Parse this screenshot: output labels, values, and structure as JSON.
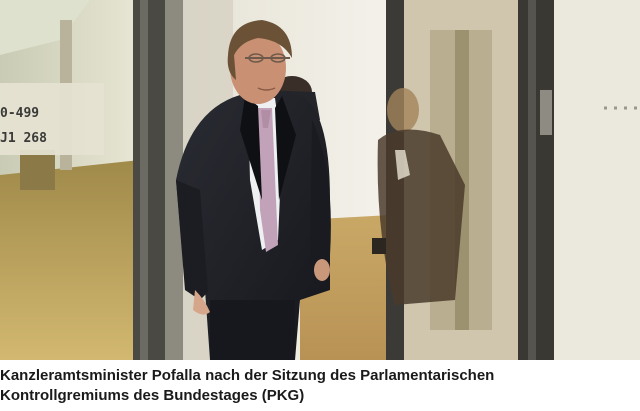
{
  "photo": {
    "sign_lines": [
      "0-499",
      "J1 268"
    ]
  },
  "caption": {
    "line1": "Kanzleramtsminister Pofalla nach der Sitzung des Parlamentarischen",
    "line2": "Kontrollgremiums des Bundestages (PKG)"
  }
}
